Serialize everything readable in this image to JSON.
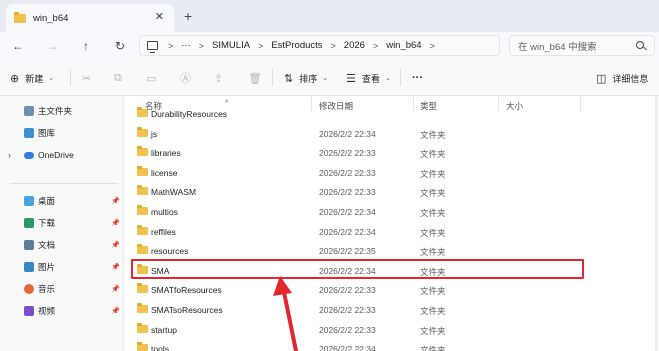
{
  "tab": {
    "title": "win_b64",
    "close": "✕",
    "new": "+"
  },
  "nav": {
    "back": "←",
    "forward": "→",
    "up": "↑",
    "refresh": "↻"
  },
  "address": {
    "ellipsis": "···",
    "crumbs": [
      "SIMULIA",
      "EstProducts",
      "2026",
      "win_b64"
    ],
    "separator": ">"
  },
  "search": {
    "placeholder": "在 win_b64 中搜索"
  },
  "commands": {
    "new_label": "新建",
    "sort_label": "排序",
    "view_label": "查看",
    "more": "···",
    "details_label": "详细信息"
  },
  "sidebar": {
    "items": [
      {
        "label": "主文件夹",
        "icon": "home-icon"
      },
      {
        "label": "图库",
        "icon": "gallery-icon"
      },
      {
        "label": "OneDrive",
        "icon": "cloud-icon"
      },
      {
        "label": "桌面",
        "icon": "desktop-icon"
      },
      {
        "label": "下载",
        "icon": "download-icon"
      },
      {
        "label": "文档",
        "icon": "document-icon"
      },
      {
        "label": "图片",
        "icon": "picture-icon"
      },
      {
        "label": "音乐",
        "icon": "music-icon"
      },
      {
        "label": "视频",
        "icon": "video-icon"
      }
    ]
  },
  "columns": {
    "name": "名称",
    "date": "修改日期",
    "type": "类型",
    "size": "大小"
  },
  "rows": [
    {
      "name": "DurabilityResources",
      "date": "",
      "type": ""
    },
    {
      "name": "js",
      "date": "2026/2/2 22:34",
      "type": "文件夹"
    },
    {
      "name": "libraries",
      "date": "2026/2/2 22:33",
      "type": "文件夹"
    },
    {
      "name": "license",
      "date": "2026/2/2 22:33",
      "type": "文件夹"
    },
    {
      "name": "MathWASM",
      "date": "2026/2/2 22:33",
      "type": "文件夹"
    },
    {
      "name": "multios",
      "date": "2026/2/2 22:34",
      "type": "文件夹"
    },
    {
      "name": "reffiles",
      "date": "2026/2/2 22:34",
      "type": "文件夹"
    },
    {
      "name": "resources",
      "date": "2026/2/2 22:35",
      "type": "文件夹"
    },
    {
      "name": "SMA",
      "date": "2026/2/2 22:34",
      "type": "文件夹"
    },
    {
      "name": "SMATfoResources",
      "date": "2026/2/2 22:33",
      "type": "文件夹"
    },
    {
      "name": "SMATsoResources",
      "date": "2026/2/2 22:33",
      "type": "文件夹"
    },
    {
      "name": "startup",
      "date": "2026/2/2 22:33",
      "type": "文件夹"
    },
    {
      "name": "tools",
      "date": "2026/2/2 22:34",
      "type": "文件夹"
    }
  ],
  "colors": {
    "highlight": "#e3262f",
    "folder": "#f2c14e"
  }
}
